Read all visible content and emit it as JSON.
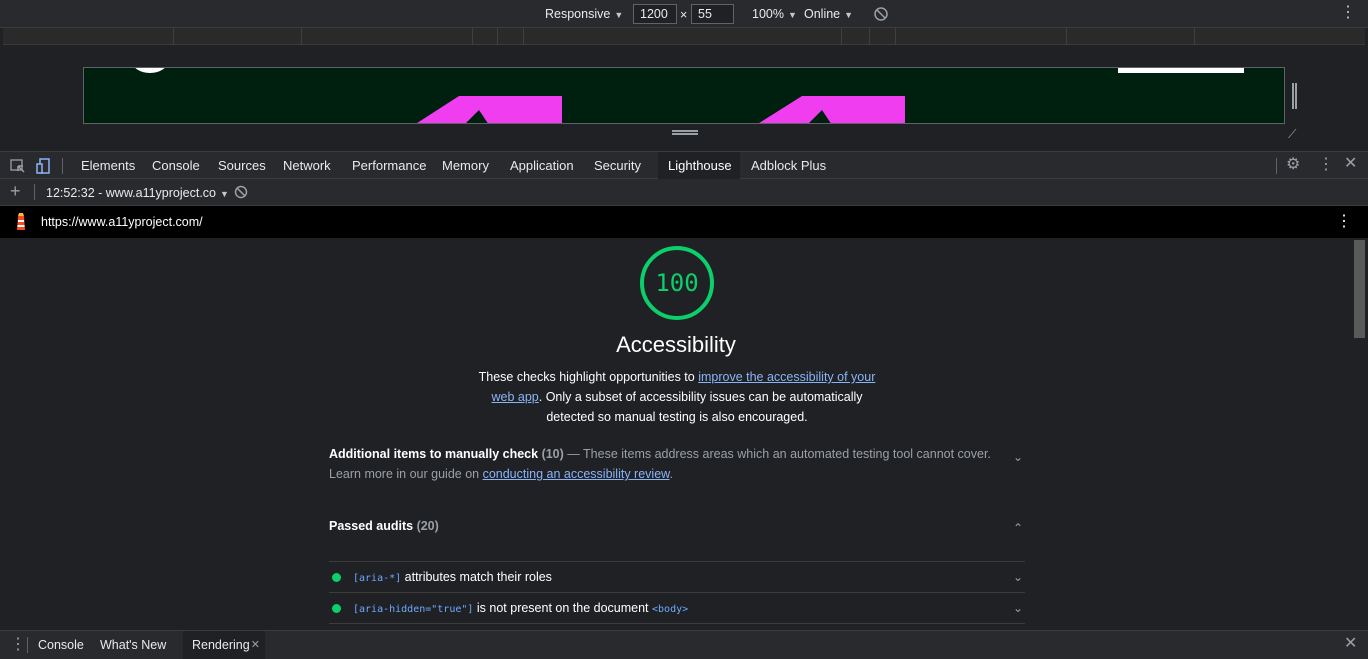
{
  "device_toolbar": {
    "device": "Responsive",
    "width": "1200",
    "times": "×",
    "height": "55",
    "zoom": "100%",
    "throttle": "Online"
  },
  "devtools_tabs": [
    "Elements",
    "Console",
    "Sources",
    "Network",
    "Performance",
    "Memory",
    "Application",
    "Security",
    "Lighthouse",
    "Adblock Plus"
  ],
  "active_tab": "Lighthouse",
  "report_selector": "12:52:32 - www.a11yproject.co",
  "report_url": "https://www.a11yproject.com/",
  "category": {
    "score": "100",
    "title": "Accessibility",
    "desc_before": "These checks highlight opportunities to ",
    "desc_link": "improve the accessibility of your web app",
    "desc_after": ". Only a subset of accessibility issues can be automatically detected so manual testing is also encouraged."
  },
  "manual_group": {
    "title": "Additional items to manually check",
    "count": "(10)",
    "dash": "—",
    "desc": " These items address areas which an automated testing tool cannot cover. Learn more in our guide on ",
    "link": "conducting an accessibility review",
    "end": "."
  },
  "passed_group": {
    "title": "Passed audits",
    "count": "(20)"
  },
  "audits": [
    {
      "code": "[aria-*]",
      "text": " attributes match their roles",
      "code2": ""
    },
    {
      "code": "[aria-hidden=\"true\"]",
      "text": " is not present on the document ",
      "code2": "<body>"
    }
  ],
  "drawer_tabs": [
    "Console",
    "What's New",
    "Rendering"
  ],
  "drawer_active": "Rendering",
  "colors": {
    "pass": "#0cce6b",
    "link": "#8ab4f8",
    "viewport_bg": "#00200f",
    "shape_magenta": "#f13df0"
  }
}
